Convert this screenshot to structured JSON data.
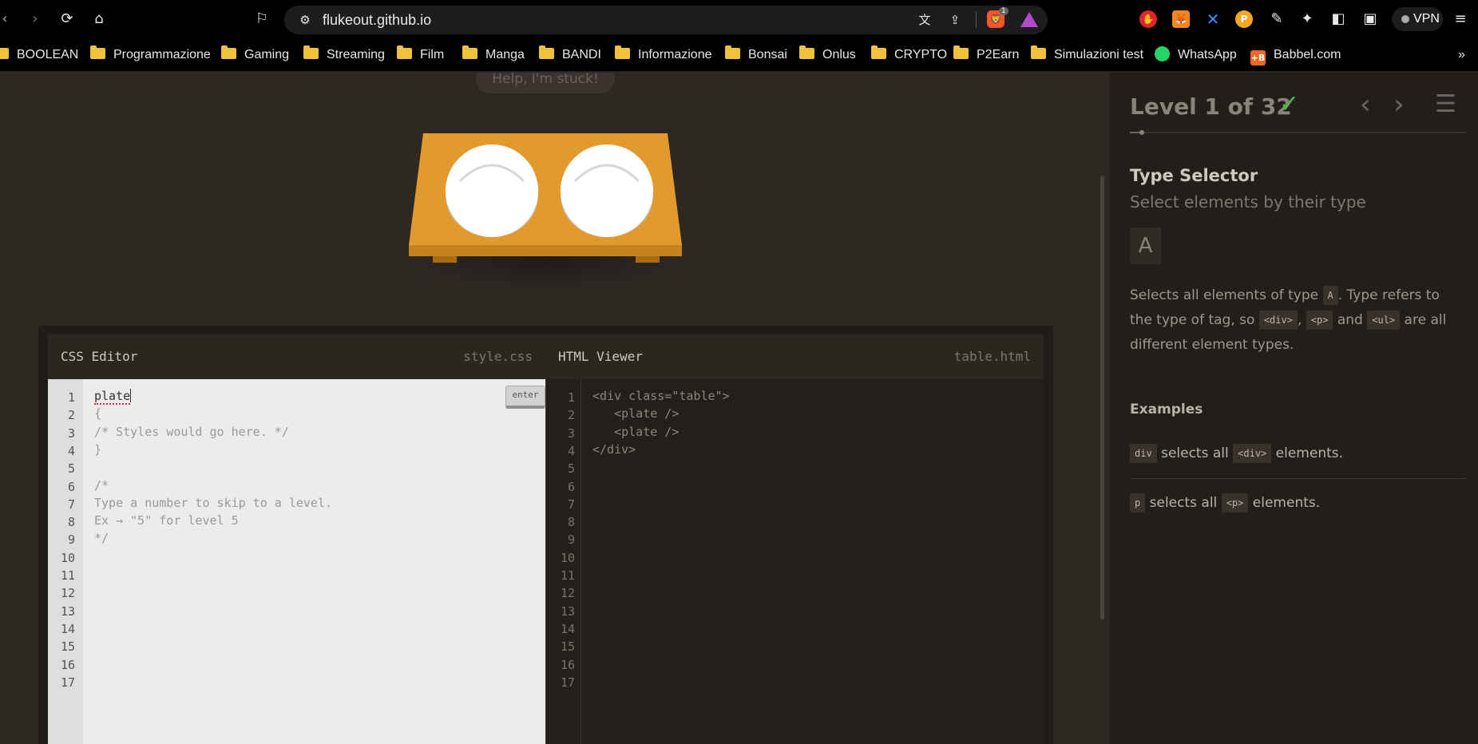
{
  "browser": {
    "url": "flukeout.github.io",
    "vpn_label": "VPN",
    "bookmarks": [
      {
        "label": "BOOLEAN",
        "type": "folder"
      },
      {
        "label": "Programmazione",
        "type": "folder"
      },
      {
        "label": "Gaming",
        "type": "folder"
      },
      {
        "label": "Streaming",
        "type": "folder"
      },
      {
        "label": "Film",
        "type": "folder"
      },
      {
        "label": "Manga",
        "type": "folder"
      },
      {
        "label": "BANDI",
        "type": "folder"
      },
      {
        "label": "Informazione",
        "type": "folder"
      },
      {
        "label": "Bonsai",
        "type": "folder"
      },
      {
        "label": "Onlus",
        "type": "folder"
      },
      {
        "label": "CRYPTO",
        "type": "folder"
      },
      {
        "label": "P2Earn",
        "type": "folder"
      },
      {
        "label": "Simulazioni test",
        "type": "folder"
      },
      {
        "label": "WhatsApp",
        "type": "site"
      },
      {
        "label": "Babbel.com",
        "type": "site"
      }
    ],
    "overflow_label": "»",
    "shields_count": "1"
  },
  "page": {
    "help_label": "Help, I'm stuck!",
    "css_editor": {
      "title": "CSS Editor",
      "file": "style.css",
      "enter_label": "enter",
      "input_value": "plate",
      "lines": [
        "{",
        "/* Styles would go here. */",
        "}",
        "",
        "/*",
        "Type a number to skip to a level.",
        "Ex → \"5\" for level 5",
        "*/"
      ],
      "line_numbers": [
        "1",
        "2",
        "3",
        "4",
        "5",
        "6",
        "7",
        "8",
        "9",
        "10",
        "11",
        "12",
        "13",
        "14",
        "15",
        "16",
        "17"
      ]
    },
    "html_viewer": {
      "title": "HTML Viewer",
      "file": "table.html",
      "lines": [
        "<div class=\"table\">",
        "   <plate />",
        "   <plate />",
        "</div>"
      ],
      "line_numbers": [
        "1",
        "2",
        "3",
        "4",
        "5",
        "6",
        "7",
        "8",
        "9",
        "10",
        "11",
        "12",
        "13",
        "14",
        "15",
        "16",
        "17"
      ]
    }
  },
  "sidebar": {
    "level_label": "Level 1 of 32",
    "level_progress": 0.03,
    "selector_name": "Type Selector",
    "selector_subtitle": "Select elements by their type",
    "syntax": "A",
    "description": {
      "part1": "Selects all elements of type ",
      "code1": "A",
      "part2": ". Type refers to the type of tag, so ",
      "code2": "<div>",
      "part3": ", ",
      "code3": "<p>",
      "part4": " and ",
      "code4": "<ul>",
      "part5": " are all different element types."
    },
    "examples_title": "Examples",
    "examples": [
      {
        "code": "div",
        "text": " selects all ",
        "tag": "<div>",
        "tail": " elements."
      },
      {
        "code": "p",
        "text": " selects all ",
        "tag": "<p>",
        "tail": " elements."
      }
    ]
  },
  "colors": {
    "accent_check": "#4cbb4c",
    "table_top": "#e09a2e",
    "plate": "#ffffff"
  }
}
